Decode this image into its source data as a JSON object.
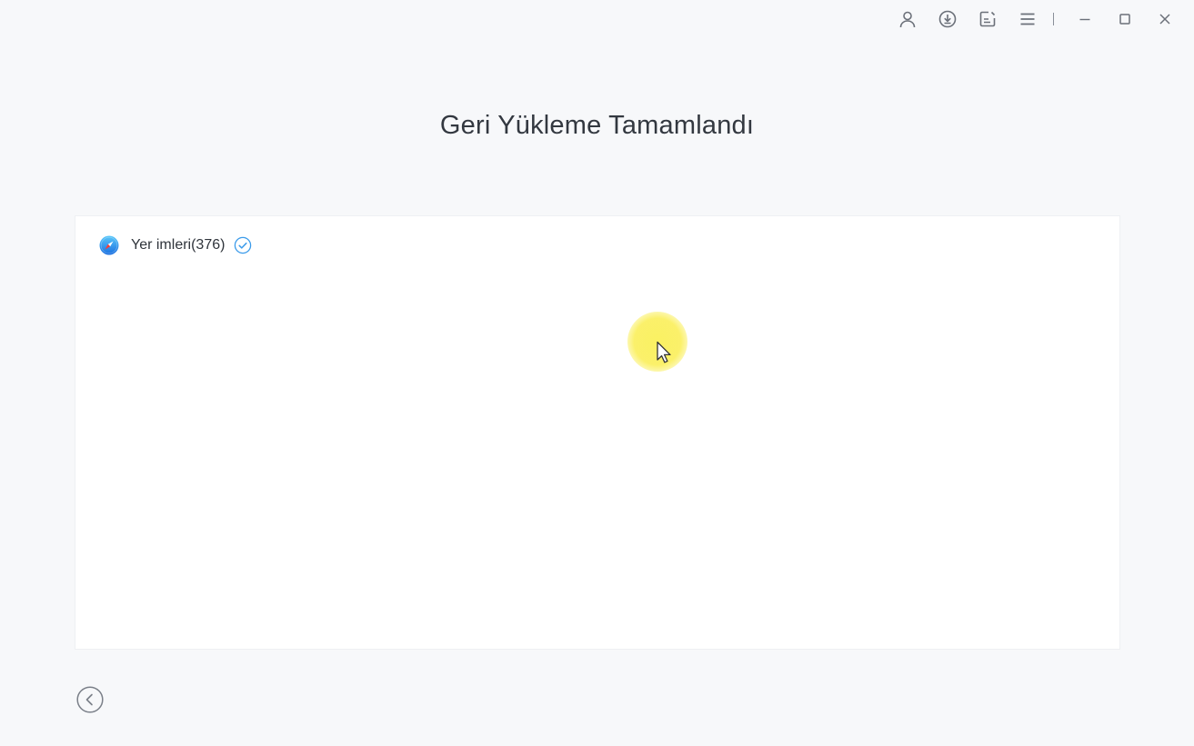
{
  "window": {
    "title": "Geri Yükleme Tamamlandı"
  },
  "titlebar": {
    "icons": [
      "user-icon",
      "download-icon",
      "feedback-icon",
      "menu-icon",
      "minimize-icon",
      "maximize-icon",
      "close-icon"
    ]
  },
  "results": {
    "items": [
      {
        "label": "Yer imleri(376)",
        "icon": "safari-compass-icon",
        "status": "check-circle-icon"
      }
    ]
  },
  "footer": {
    "back_icon": "back-arrow-icon"
  },
  "colors": {
    "background": "#f7f8fa",
    "panel": "#ffffff",
    "accent_blue": "#3b9bea",
    "text": "#333840",
    "icon_gray": "#6b7079"
  }
}
